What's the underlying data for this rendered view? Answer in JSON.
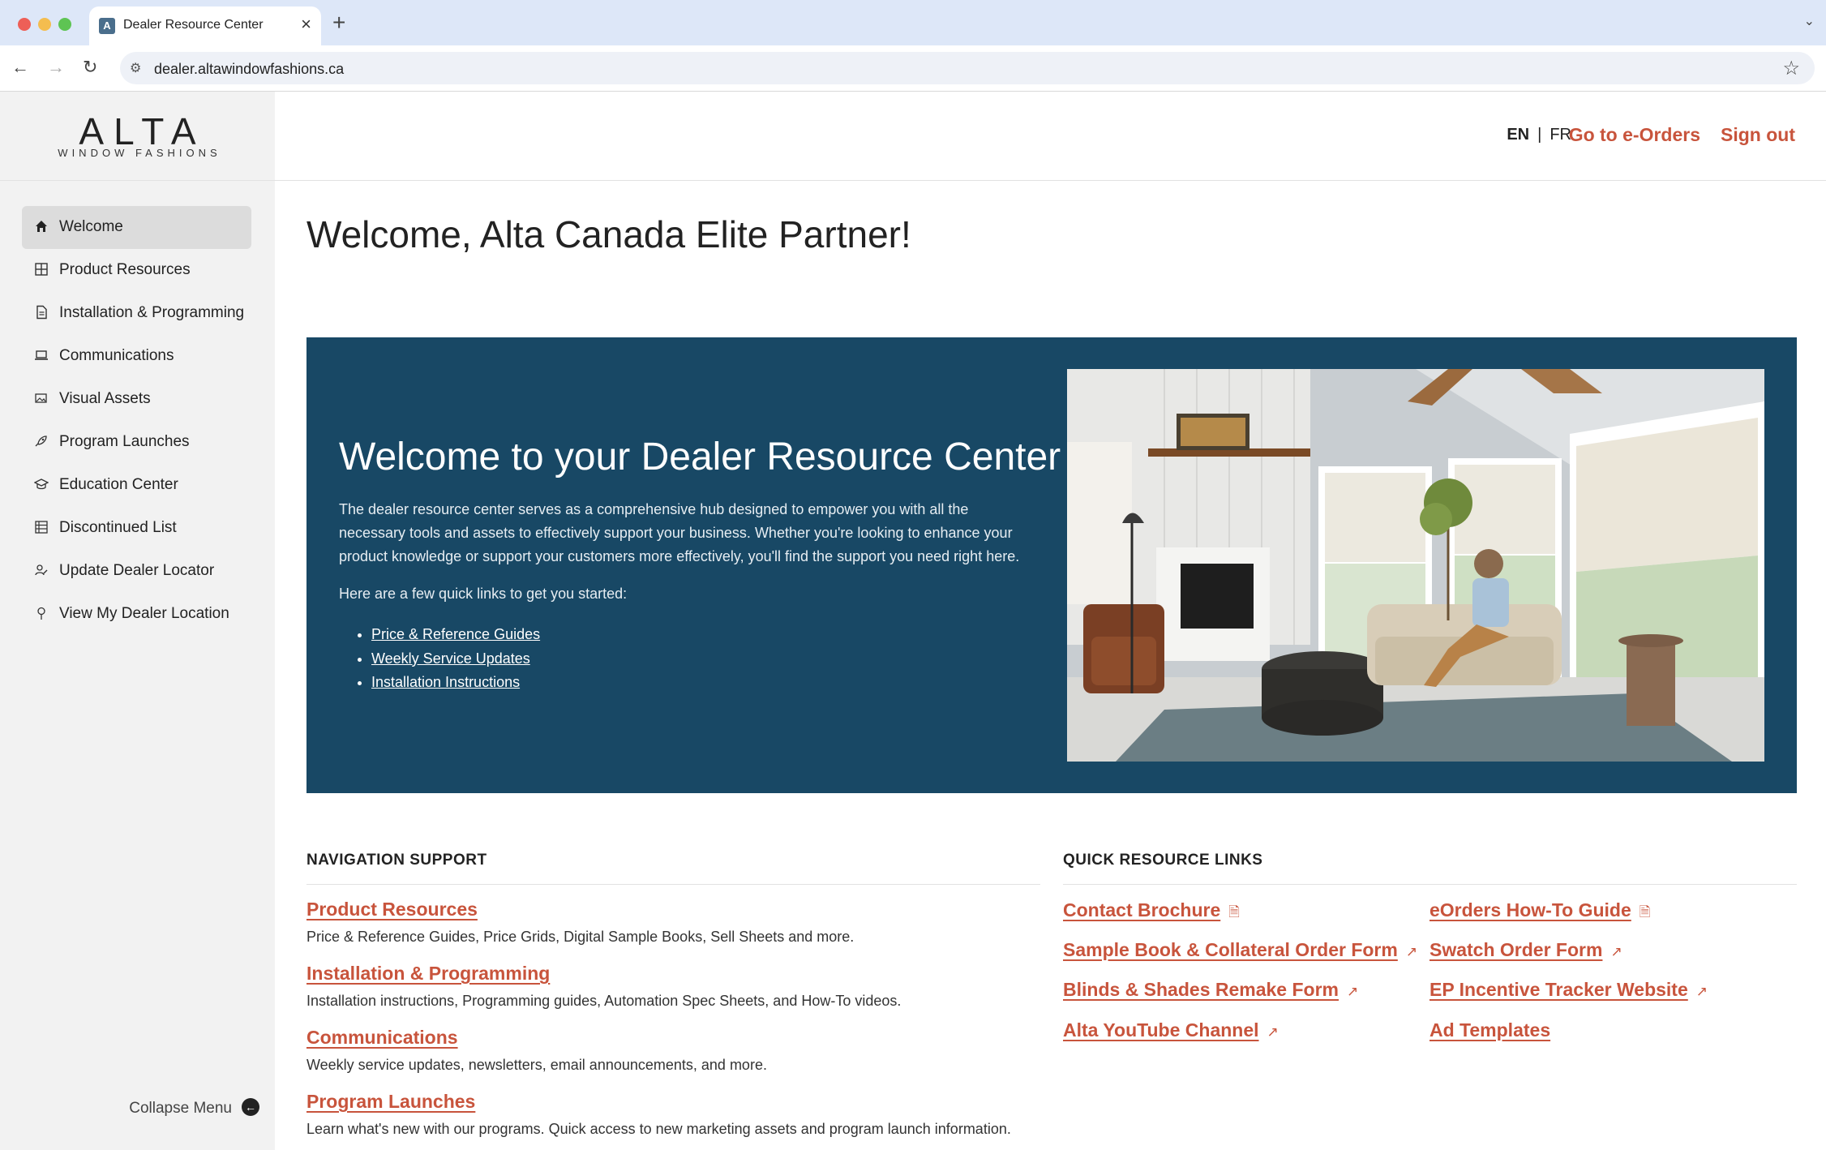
{
  "browser": {
    "tab_title": "Dealer Resource Center",
    "tab_favicon_letter": "A",
    "url": "dealer.altawindowfashions.ca"
  },
  "logo": {
    "main": "ALTA",
    "sub": "WINDOW FASHIONS"
  },
  "sidebar": {
    "items": [
      {
        "label": "Welcome",
        "icon": "home-icon",
        "active": true
      },
      {
        "label": "Product Resources",
        "icon": "grid-icon"
      },
      {
        "label": "Installation & Programming",
        "icon": "document-icon"
      },
      {
        "label": "Communications",
        "icon": "laptop-icon"
      },
      {
        "label": "Visual Assets",
        "icon": "images-icon"
      },
      {
        "label": "Program Launches",
        "icon": "rocket-icon"
      },
      {
        "label": "Education Center",
        "icon": "graduation-cap-icon"
      },
      {
        "label": "Discontinued List",
        "icon": "list-icon"
      },
      {
        "label": "Update Dealer Locator",
        "icon": "user-edit-icon"
      },
      {
        "label": "View My Dealer Location",
        "icon": "map-pin-icon"
      }
    ],
    "collapse_label": "Collapse Menu"
  },
  "header": {
    "lang_en": "EN",
    "lang_sep": "|",
    "lang_fr": "FR",
    "eorders": "Go to e-Orders",
    "signout": "Sign out"
  },
  "main": {
    "title": "Welcome, Alta Canada Elite Partner!",
    "hero": {
      "title": "Welcome to your Dealer Resource Center",
      "description": "The dealer resource center serves as a comprehensive hub designed to empower you with all the necessary tools and assets to effectively support your business. Whether you're looking to enhance your product knowledge or support your customers more effectively, you'll find the support you need right here.",
      "intro": "Here are a few quick links to get you started:",
      "links": [
        "Price & Reference Guides",
        "Weekly Service Updates",
        "Installation Instructions"
      ]
    },
    "navigation_support": {
      "heading": "NAVIGATION SUPPORT",
      "items": [
        {
          "title": "Product Resources",
          "desc": "Price & Reference Guides, Price Grids, Digital Sample Books, Sell Sheets and more."
        },
        {
          "title": "Installation & Programming",
          "desc": "Installation instructions, Programming guides, Automation Spec Sheets, and How-To videos."
        },
        {
          "title": "Communications",
          "desc": "Weekly service updates, newsletters, email announcements, and more."
        },
        {
          "title": "Program Launches",
          "desc": "Learn what's new with our programs. Quick access to new marketing assets and program launch information."
        }
      ]
    },
    "quick_links": {
      "heading": "QUICK RESOURCE LINKS",
      "col1": [
        {
          "label": "Contact Brochure",
          "icon": "pdf-icon"
        },
        {
          "label": "Sample Book & Collateral Order Form",
          "icon": "external-link-icon"
        },
        {
          "label": "Blinds & Shades Remake Form",
          "icon": "external-link-icon"
        },
        {
          "label": "Alta YouTube Channel",
          "icon": "external-link-icon"
        }
      ],
      "col2": [
        {
          "label": "eOrders How-To Guide",
          "icon": "pdf-icon"
        },
        {
          "label": "Swatch Order Form",
          "icon": "external-link-icon"
        },
        {
          "label": "EP Incentive Tracker Website",
          "icon": "external-link-icon"
        },
        {
          "label": "Ad Templates",
          "icon": ""
        }
      ]
    }
  },
  "colors": {
    "accent": "#c8543c",
    "hero_bg": "#184865",
    "sidebar_bg": "#f2f2f2"
  }
}
